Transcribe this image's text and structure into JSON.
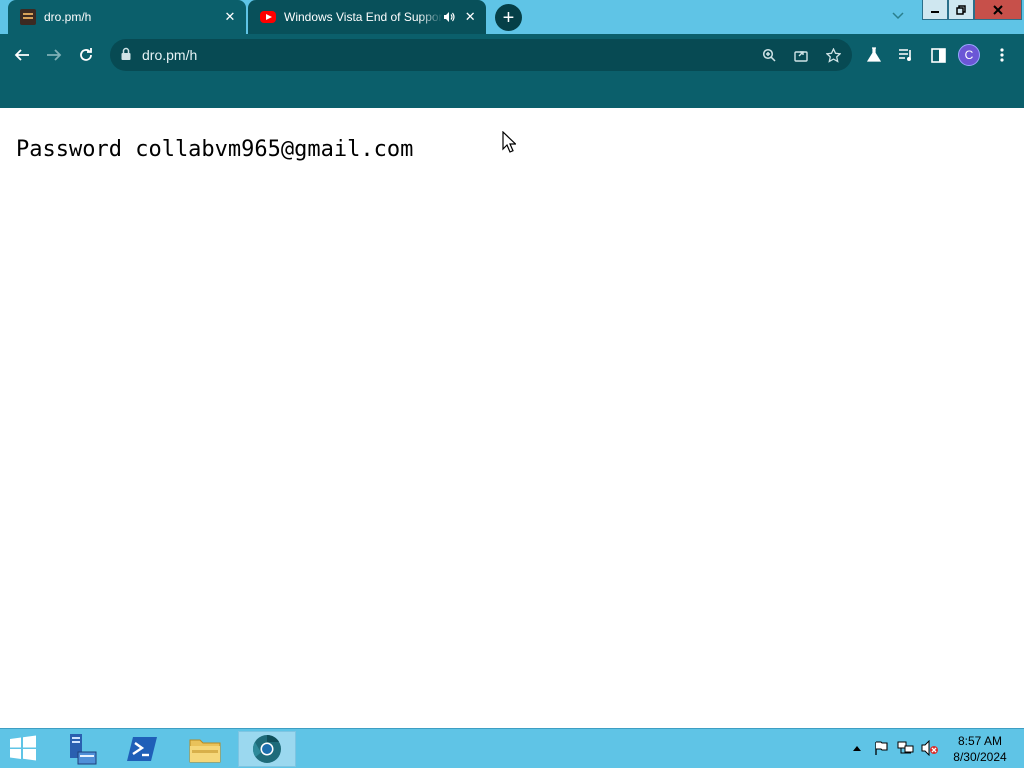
{
  "browser": {
    "tabs": [
      {
        "title": "dro.pm/h",
        "active": true
      },
      {
        "title": "Windows Vista End of Support",
        "active": false
      }
    ],
    "address_bar": {
      "url": "dro.pm/h"
    },
    "profile_initial": "C"
  },
  "page": {
    "text": "Password collabvm965@gmail.com"
  },
  "taskbar": {
    "apps": [
      "server-manager",
      "powershell",
      "file-explorer",
      "chrome"
    ],
    "clock": {
      "time": "8:57 AM",
      "date": "8/30/2024"
    }
  },
  "colors": {
    "tabstrip": "#5fc4e6",
    "toolbar": "#0b5f6b",
    "taskbar": "#5fc4e6"
  }
}
